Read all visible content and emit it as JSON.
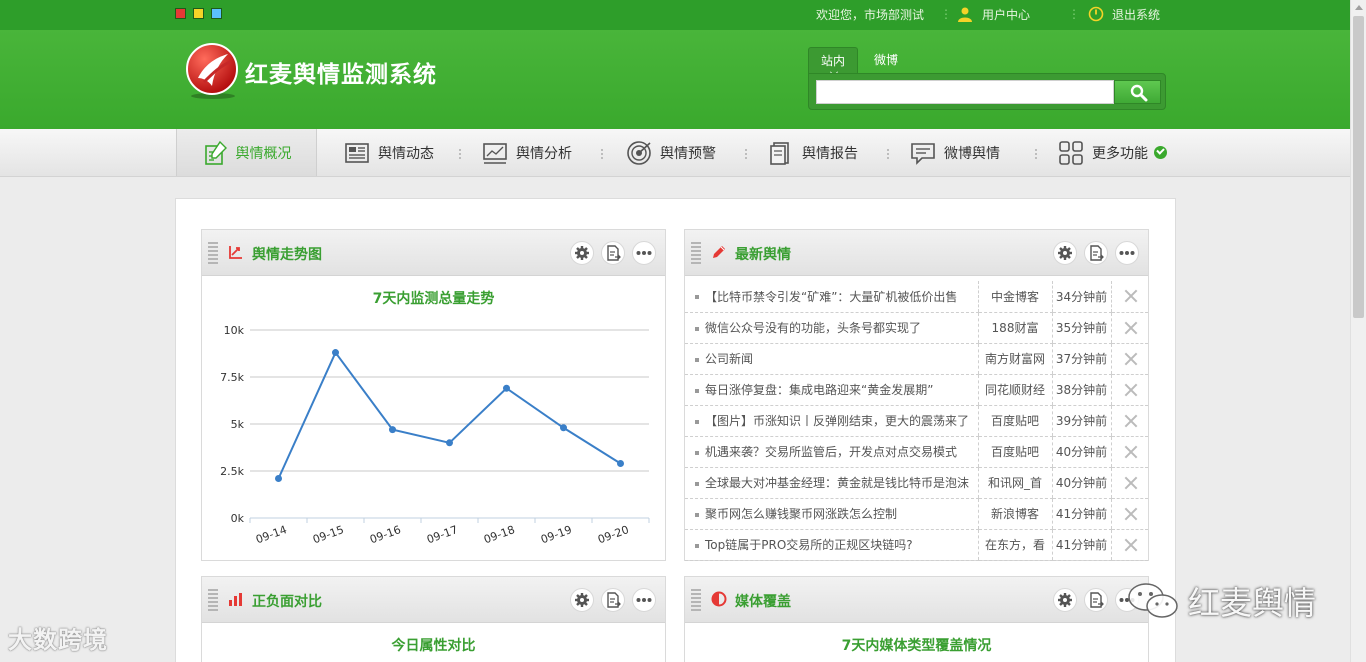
{
  "topbar": {
    "welcome": "欢迎您，市场部测试",
    "user_center": "用户中心",
    "logout": "退出系统"
  },
  "header": {
    "title": "红麦舆情监测系统",
    "search": {
      "tab_site": "站内",
      "tab_weibo": "微博",
      "placeholder": ""
    }
  },
  "nav": {
    "items": [
      {
        "label": "舆情概况",
        "icon": "overview-icon"
      },
      {
        "label": "舆情动态",
        "icon": "news-icon"
      },
      {
        "label": "舆情分析",
        "icon": "analysis-icon"
      },
      {
        "label": "舆情预警",
        "icon": "warning-target-icon"
      },
      {
        "label": "舆情报告",
        "icon": "report-icon"
      },
      {
        "label": "微博舆情",
        "icon": "weibo-comment-icon"
      },
      {
        "label": "更多功能",
        "icon": "more-grid-icon"
      }
    ]
  },
  "panels": {
    "trend": {
      "title": "舆情走势图",
      "subtitle": "7天内监测总量走势"
    },
    "latest": {
      "title": "最新舆情"
    },
    "polarity": {
      "title": "正负面对比",
      "subtitle": "今日属性对比"
    },
    "media": {
      "title": "媒体覆盖",
      "subtitle": "7天内媒体类型覆盖情况"
    }
  },
  "news": [
    {
      "title": "【比特币禁令引发“矿难”：大量矿机被低价出售",
      "source": "中金博客",
      "time": "34分钟前"
    },
    {
      "title": "微信公众号没有的功能，头条号都实现了",
      "source": "188财富",
      "time": "35分钟前"
    },
    {
      "title": "公司新闻",
      "source": "南方财富网",
      "time": "37分钟前"
    },
    {
      "title": "每日涨停复盘：集成电路迎来“黄金发展期”",
      "source": "同花顺财经",
      "time": "38分钟前"
    },
    {
      "title": "【图片】币涨知识丨反弹刚结束，更大的震荡来了",
      "source": "百度贴吧",
      "time": "39分钟前"
    },
    {
      "title": "机遇来袭？交易所监管后，开发点对点交易模式",
      "source": "百度贴吧",
      "time": "40分钟前"
    },
    {
      "title": "全球最大对冲基金经理：黄金就是钱比特币是泡沫",
      "source": "和讯网_首",
      "time": "40分钟前"
    },
    {
      "title": "聚币网怎么赚钱聚币网涨跌怎么控制",
      "source": "新浪博客",
      "time": "41分钟前"
    },
    {
      "title": "Top链属于PRO交易所的正规区块链吗?",
      "source": "在东方，看",
      "time": "41分钟前"
    }
  ],
  "chart_data": {
    "type": "line",
    "categories": [
      "09-14",
      "09-15",
      "09-16",
      "09-17",
      "09-18",
      "09-19",
      "09-20"
    ],
    "values": [
      2100,
      8800,
      4700,
      4000,
      6900,
      4800,
      2900
    ],
    "ylim": [
      0,
      10000
    ],
    "yticks": [
      0,
      2500,
      5000,
      7500,
      10000
    ],
    "ytick_labels": [
      "0k",
      "2.5k",
      "5k",
      "7.5k",
      "10k"
    ],
    "grid": true,
    "color": "#3a7fc8"
  },
  "watermarks": {
    "left": "大数跨境",
    "right": "红麦舆情"
  },
  "colors": {
    "brand_green": "#3aa92d",
    "title_green": "#3a9f32",
    "line_blue": "#3a7fc8"
  }
}
